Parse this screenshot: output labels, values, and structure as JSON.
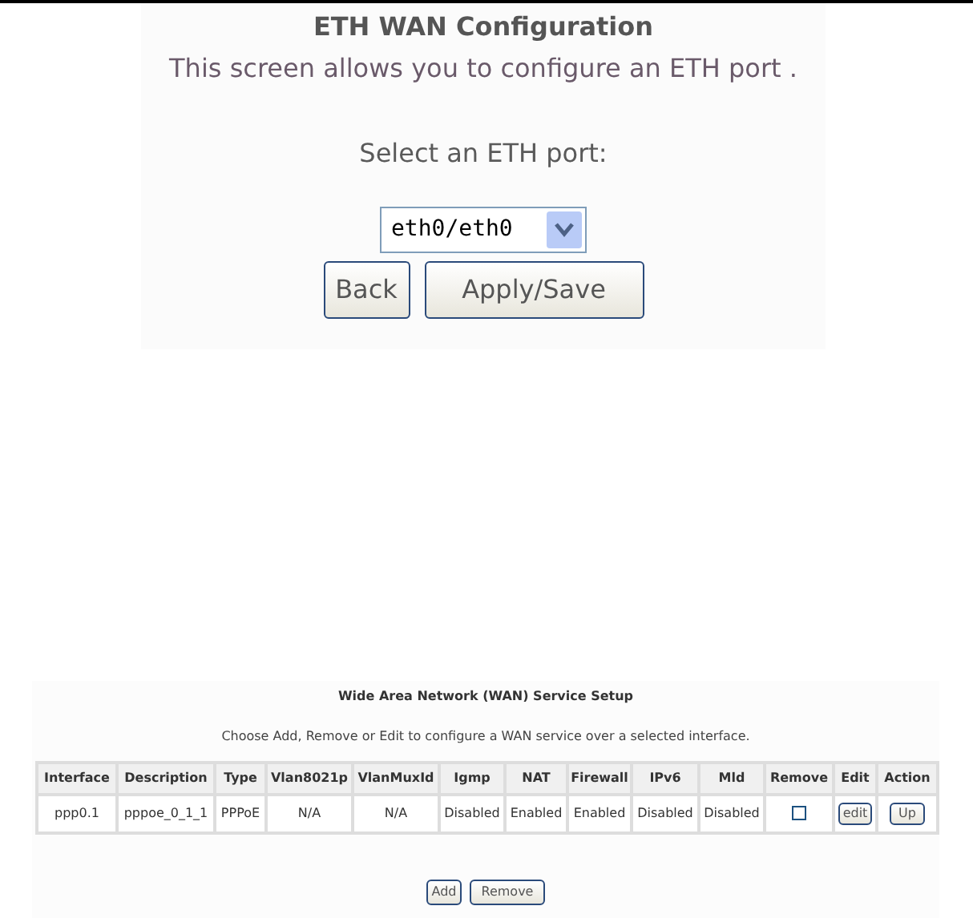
{
  "eth_config": {
    "title": "ETH WAN Configuration",
    "subtitle": "This screen allows you to configure an ETH port .",
    "port_label": "Select an ETH port:",
    "port_value": "eth0/eth0",
    "buttons": [
      "Back",
      "Apply/Save"
    ]
  },
  "wan_setup": {
    "title": "Wide Area Network (WAN) Service Setup",
    "description": "Choose Add, Remove or Edit to configure a WAN service over a selected interface.",
    "columns": [
      "Interface",
      "Description",
      "Type",
      "Vlan8021p",
      "VlanMuxId",
      "Igmp",
      "NAT",
      "Firewall",
      "IPv6",
      "Mld",
      "Remove",
      "Edit",
      "Action"
    ],
    "rows": [
      {
        "cells": [
          "ppp0.1",
          "pppoe_0_1_1",
          "PPPoE",
          "N/A",
          "N/A",
          "Disabled",
          "Enabled",
          "Enabled",
          "Disabled",
          "Disabled"
        ],
        "remove_checked": false,
        "edit": "edit",
        "action": "Up"
      }
    ],
    "buttons": [
      "Add",
      "Remove"
    ]
  }
}
